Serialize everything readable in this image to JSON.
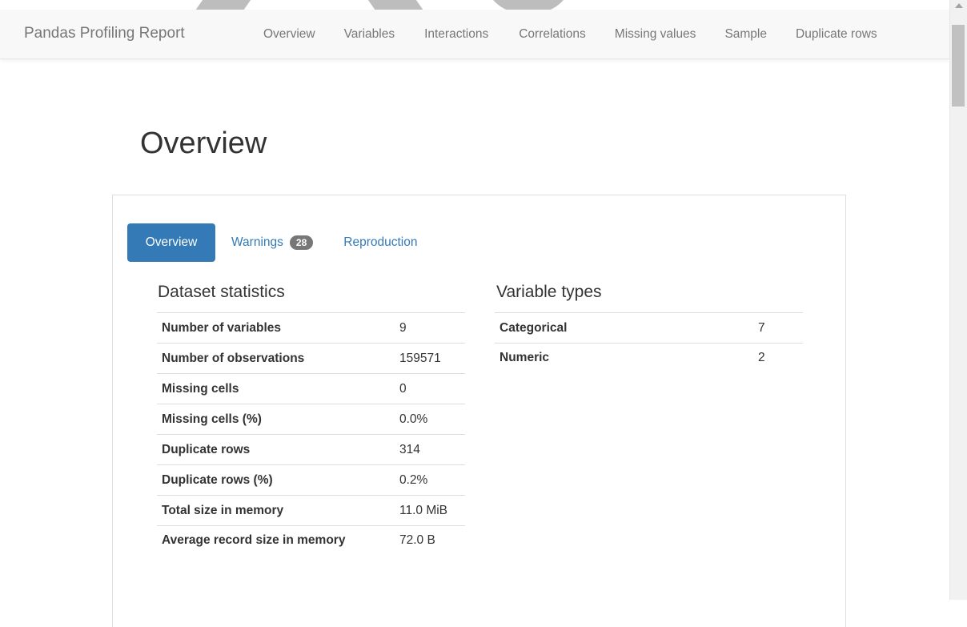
{
  "navbar": {
    "brand": "Pandas Profiling Report",
    "links": [
      "Overview",
      "Variables",
      "Interactions",
      "Correlations",
      "Missing values",
      "Sample",
      "Duplicate rows"
    ]
  },
  "page": {
    "title": "Overview"
  },
  "tabs": {
    "overview": "Overview",
    "warnings": "Warnings",
    "warnings_count": "28",
    "reproduction": "Reproduction"
  },
  "dataset_statistics": {
    "title": "Dataset statistics",
    "rows": [
      {
        "label": "Number of variables",
        "value": "9"
      },
      {
        "label": "Number of observations",
        "value": "159571"
      },
      {
        "label": "Missing cells",
        "value": "0"
      },
      {
        "label": "Missing cells (%)",
        "value": "0.0%"
      },
      {
        "label": "Duplicate rows",
        "value": "314"
      },
      {
        "label": "Duplicate rows (%)",
        "value": "0.2%"
      },
      {
        "label": "Total size in memory",
        "value": "11.0 MiB"
      },
      {
        "label": "Average record size in memory",
        "value": "72.0 B"
      }
    ]
  },
  "variable_types": {
    "title": "Variable types",
    "rows": [
      {
        "label": "Categorical",
        "value": "7"
      },
      {
        "label": "Numeric",
        "value": "2"
      }
    ]
  },
  "colors": {
    "accent": "#337ab7",
    "navbar_bg": "#f8f8f8",
    "badge": "#777777"
  }
}
